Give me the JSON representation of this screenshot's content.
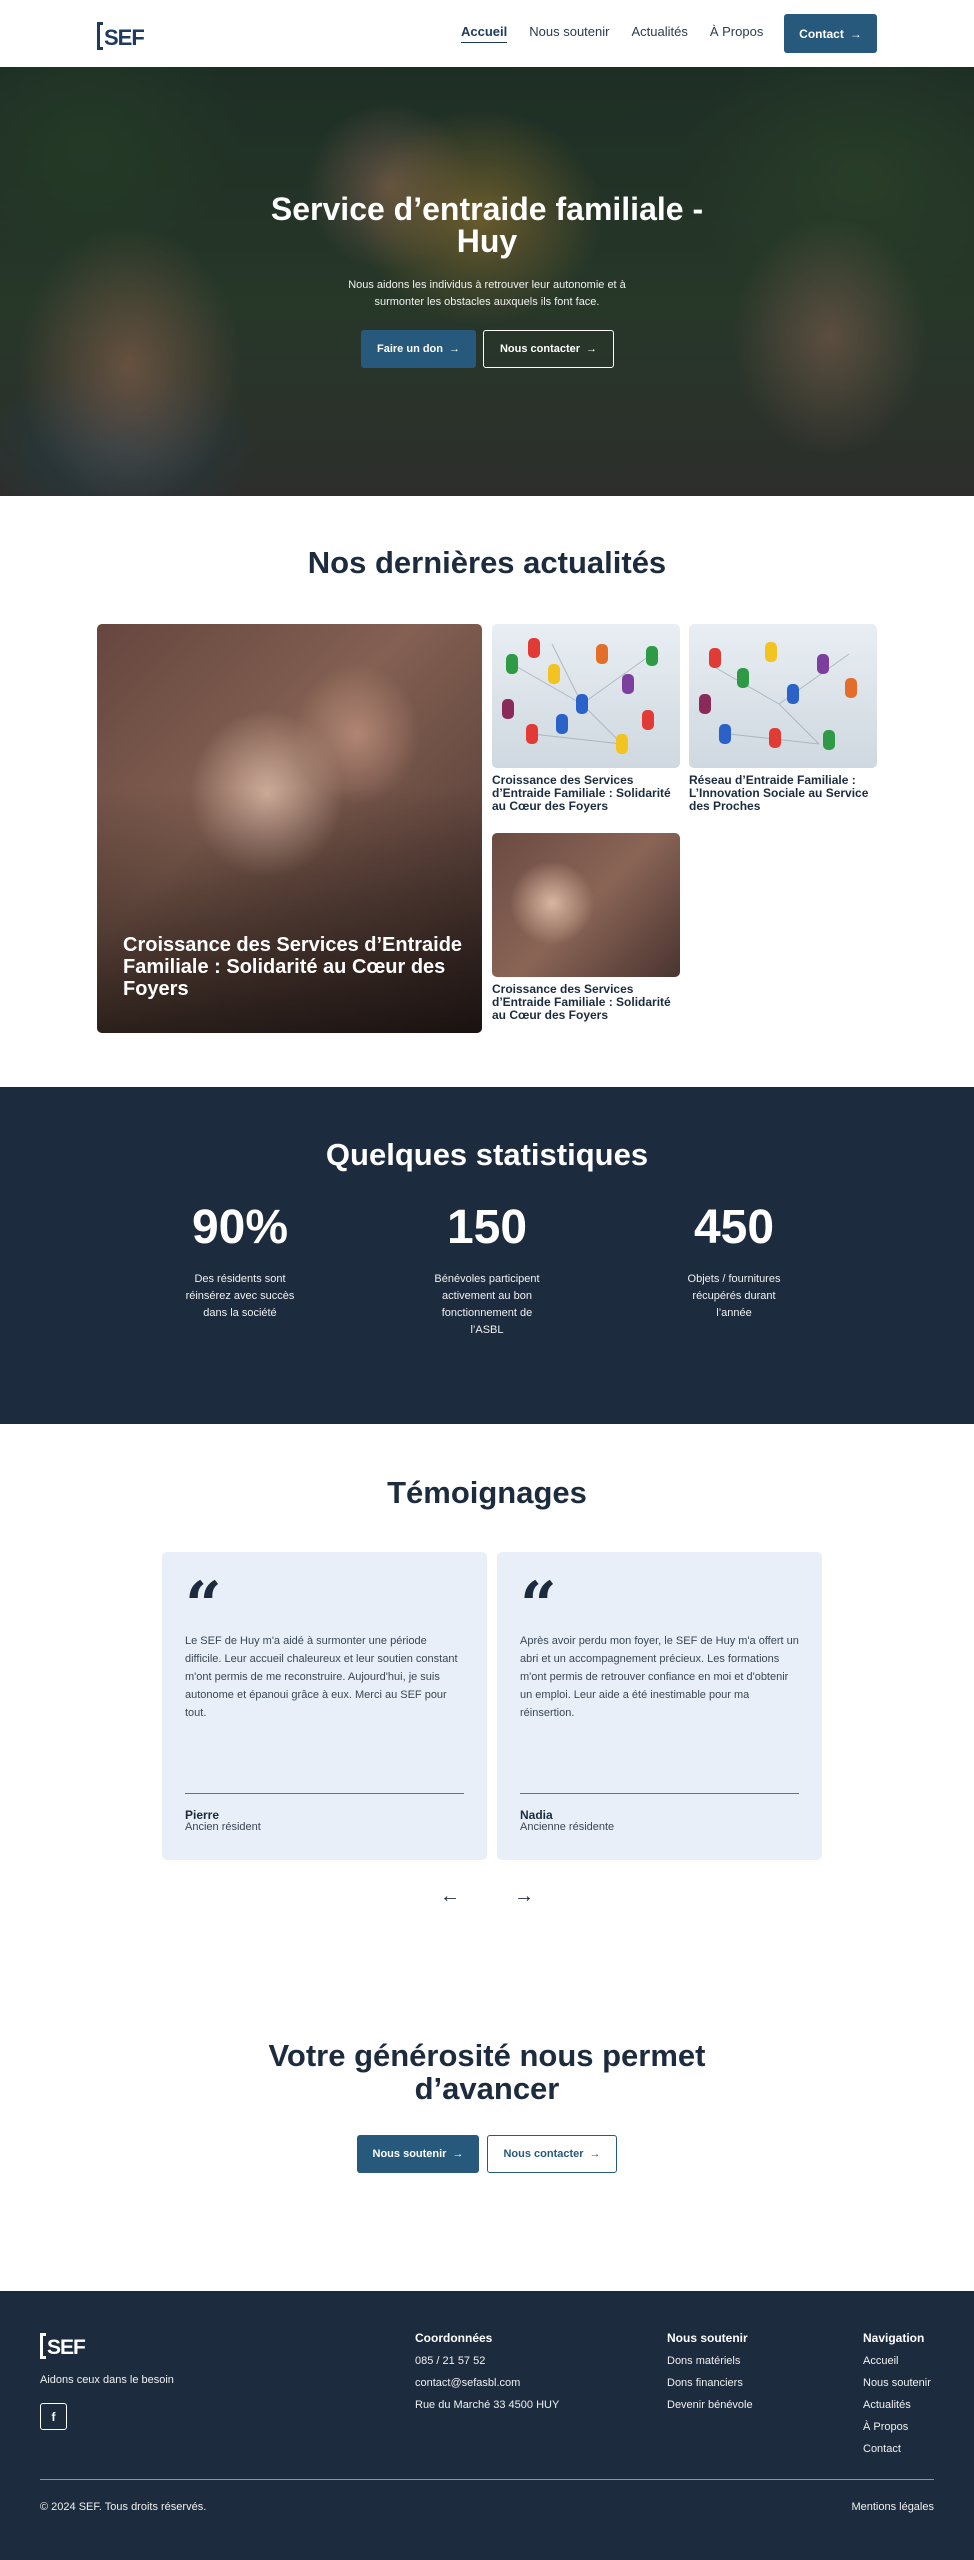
{
  "header": {
    "logo": "SEF",
    "nav": [
      "Accueil",
      "Nous soutenir",
      "Actualités",
      "À Propos"
    ],
    "contact_label": "Contact"
  },
  "hero": {
    "title": "Service d’entraide familiale - Huy",
    "subtitle": "Nous aidons les individus à retrouver leur autonomie et à surmonter les obstacles auxquels ils font face.",
    "btn_donate": "Faire un don",
    "btn_contact": "Nous contacter"
  },
  "news": {
    "title": "Nos dernières actualités",
    "featured": "Croissance des Services d’Entraide Familiale : Solidarité au Cœur des Foyers",
    "items": [
      "Croissance des Services d’Entraide Familiale : Solidarité au Cœur des Foyers",
      "Réseau d’Entraide Familiale : L’Innovation Sociale au Service des Proches",
      "Croissance des Services d’Entraide Familiale : Solidarité au Cœur des Foyers"
    ]
  },
  "stats": {
    "title": "Quelques statistiques",
    "items": [
      {
        "value": "90%",
        "label": "Des résidents sont réinsérez avec succès dans la société"
      },
      {
        "value": "150",
        "label": "Bénévoles participent activement au bon fonctionnement de l’ASBL"
      },
      {
        "value": "450",
        "label": "Objets / fournitures récupérés durant l’année"
      }
    ]
  },
  "testimonials": {
    "title": "Témoignages",
    "items": [
      {
        "text": "Le SEF de Huy m'a aidé à surmonter une période difficile. Leur accueil chaleureux et leur soutien constant m'ont permis de me reconstruire. Aujourd'hui, je suis autonome et épanoui grâce à eux. Merci au SEF pour tout.",
        "name": "Pierre",
        "role": "Ancien résident"
      },
      {
        "text": "Après avoir perdu mon foyer, le SEF de Huy m'a offert un abri et un accompagnement précieux. Les formations m'ont permis de retrouver confiance en moi et d'obtenir un emploi. Leur aide a été inestimable pour ma réinsertion.",
        "name": "Nadia",
        "role": "Ancienne résidente"
      }
    ],
    "prev_icon": "arrow-left-icon",
    "next_icon": "arrow-right-icon"
  },
  "cta": {
    "title": "Votre générosité nous permet d’avancer",
    "btn_support": "Nous soutenir",
    "btn_contact": "Nous contacter"
  },
  "footer": {
    "logo": "SEF",
    "tagline": "Aidons ceux dans le besoin",
    "social_icon": "f",
    "coords": {
      "title": "Coordonnées",
      "items": [
        "085 / 21 57 52",
        "contact@sefasbl.com",
        "Rue du Marché 33 4500 HUY"
      ]
    },
    "support": {
      "title": "Nous soutenir",
      "items": [
        "Dons matériels",
        "Dons financiers",
        "Devenir bénévole"
      ]
    },
    "navigation": {
      "title": "Navigation",
      "items": [
        "Accueil",
        "Nous soutenir",
        "Actualités",
        "À Propos",
        "Contact"
      ]
    },
    "copyright": "© 2024 SEF. Tous droits réservés.",
    "legal": "Mentions légales"
  },
  "colors": {
    "primary": "#27597c",
    "dark": "#1c2b3d",
    "card": "#e8eff8"
  }
}
